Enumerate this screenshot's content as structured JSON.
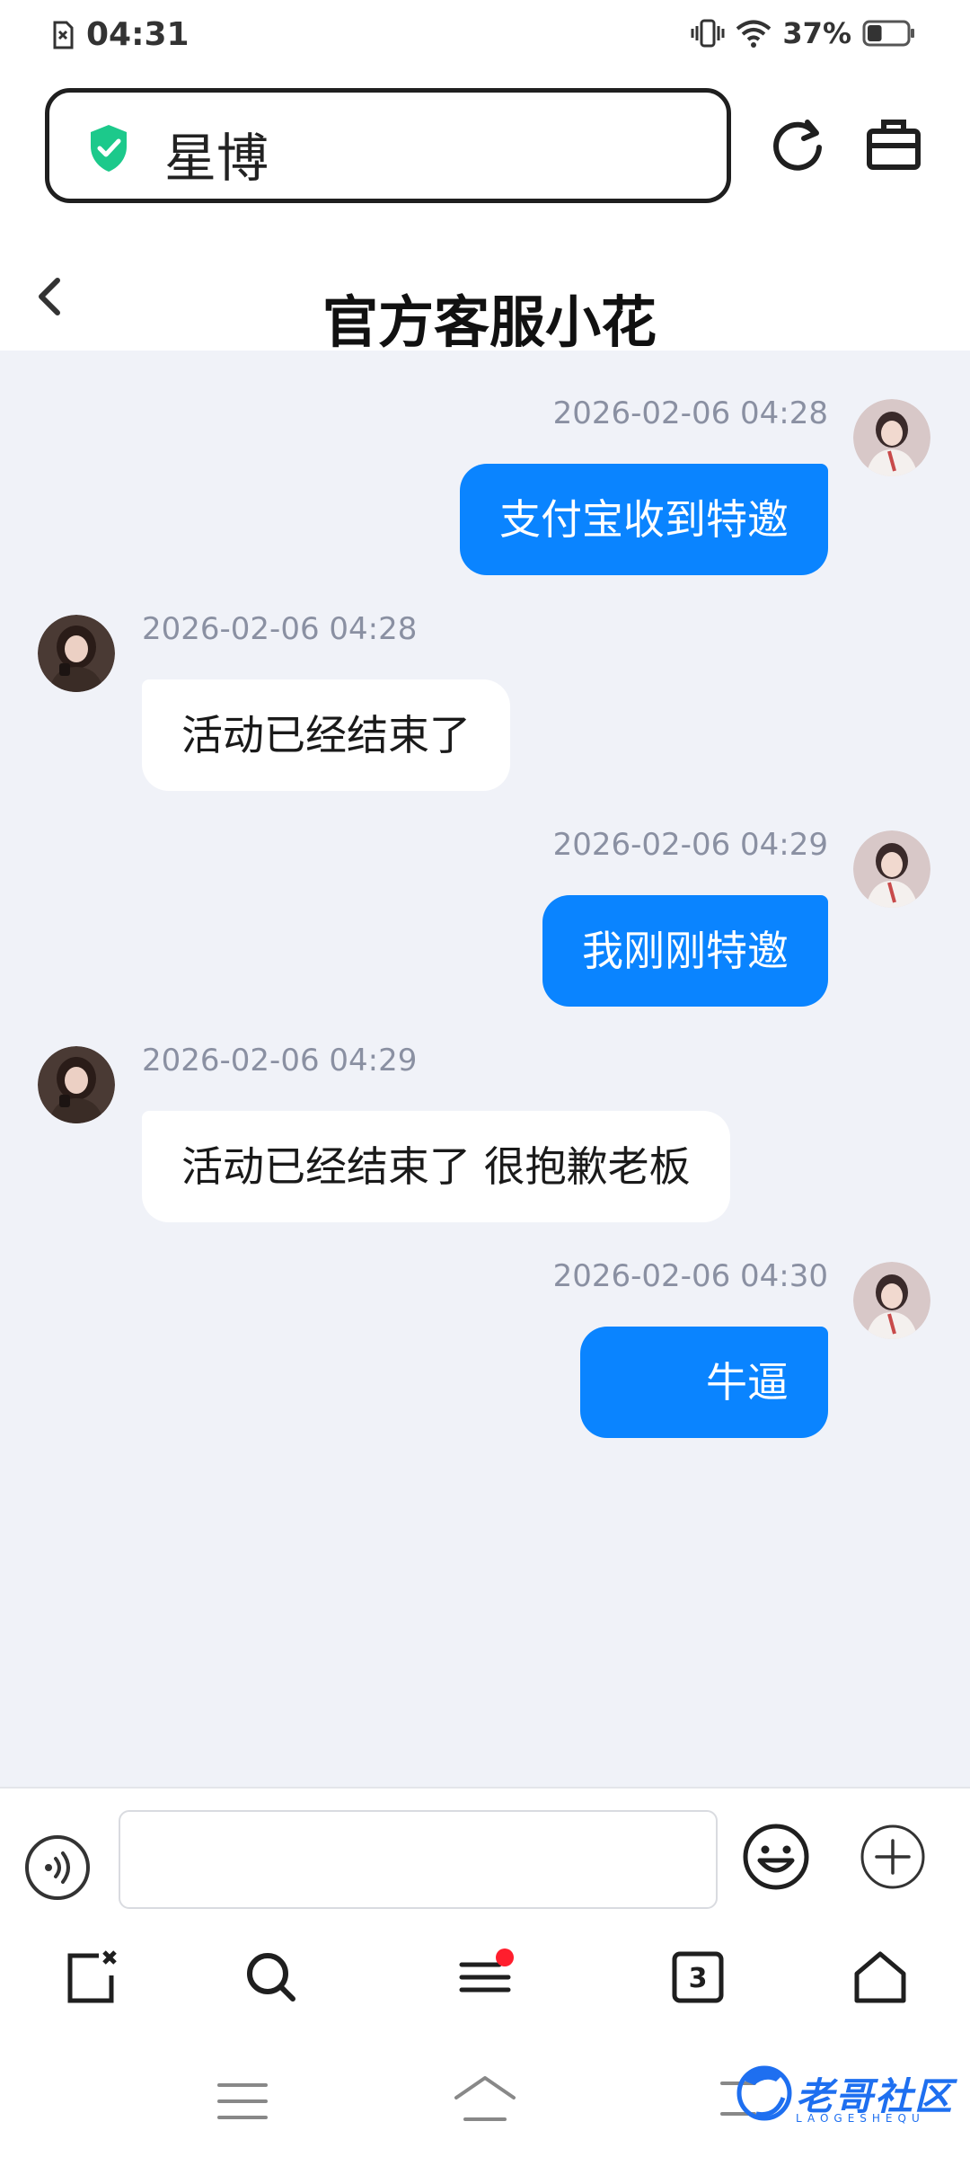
{
  "status_bar": {
    "time": "04:31",
    "battery_percent": "37%",
    "battery_level": 0.37,
    "icons": [
      "sim-error-icon",
      "vibrate-icon",
      "wifi-icon",
      "battery-icon"
    ]
  },
  "address_bar": {
    "text": "星博",
    "shield_color": "#1cc98b",
    "refresh_icon": "refresh-icon",
    "toolbox_icon": "toolbox-icon"
  },
  "chat": {
    "title": "官方客服小花",
    "back_icon": "chevron-left-icon",
    "accent_color": "#0a84ff",
    "messages": [
      {
        "direction": "out",
        "timestamp": "2026-02-06 04:28",
        "text": "支付宝收到特邀"
      },
      {
        "direction": "in",
        "timestamp": "2026-02-06 04:28",
        "text": "活动已经结束了"
      },
      {
        "direction": "out",
        "timestamp": "2026-02-06 04:29",
        "text": "我刚刚特邀"
      },
      {
        "direction": "in",
        "timestamp": "2026-02-06 04:29",
        "text": "活动已经结束了 很抱歉老板"
      },
      {
        "direction": "out",
        "timestamp": "2026-02-06 04:30",
        "text": "牛逼"
      }
    ]
  },
  "input_bar": {
    "value": "",
    "voice_icon": "voice-icon",
    "emoji_icon": "emoji-icon",
    "plus_icon": "plus-circle-icon"
  },
  "browser_nav": {
    "tab_count": "3",
    "items": [
      "close-page-icon",
      "search-icon",
      "menu-icon",
      "tabs-icon",
      "home-icon"
    ],
    "notification_dot_color": "#ff1e2d"
  },
  "system_nav": {
    "items": [
      "recents-icon",
      "home-icon",
      "back-icon"
    ]
  },
  "watermark": {
    "text": "老哥社区",
    "sub": "LAOGESHEQU"
  }
}
